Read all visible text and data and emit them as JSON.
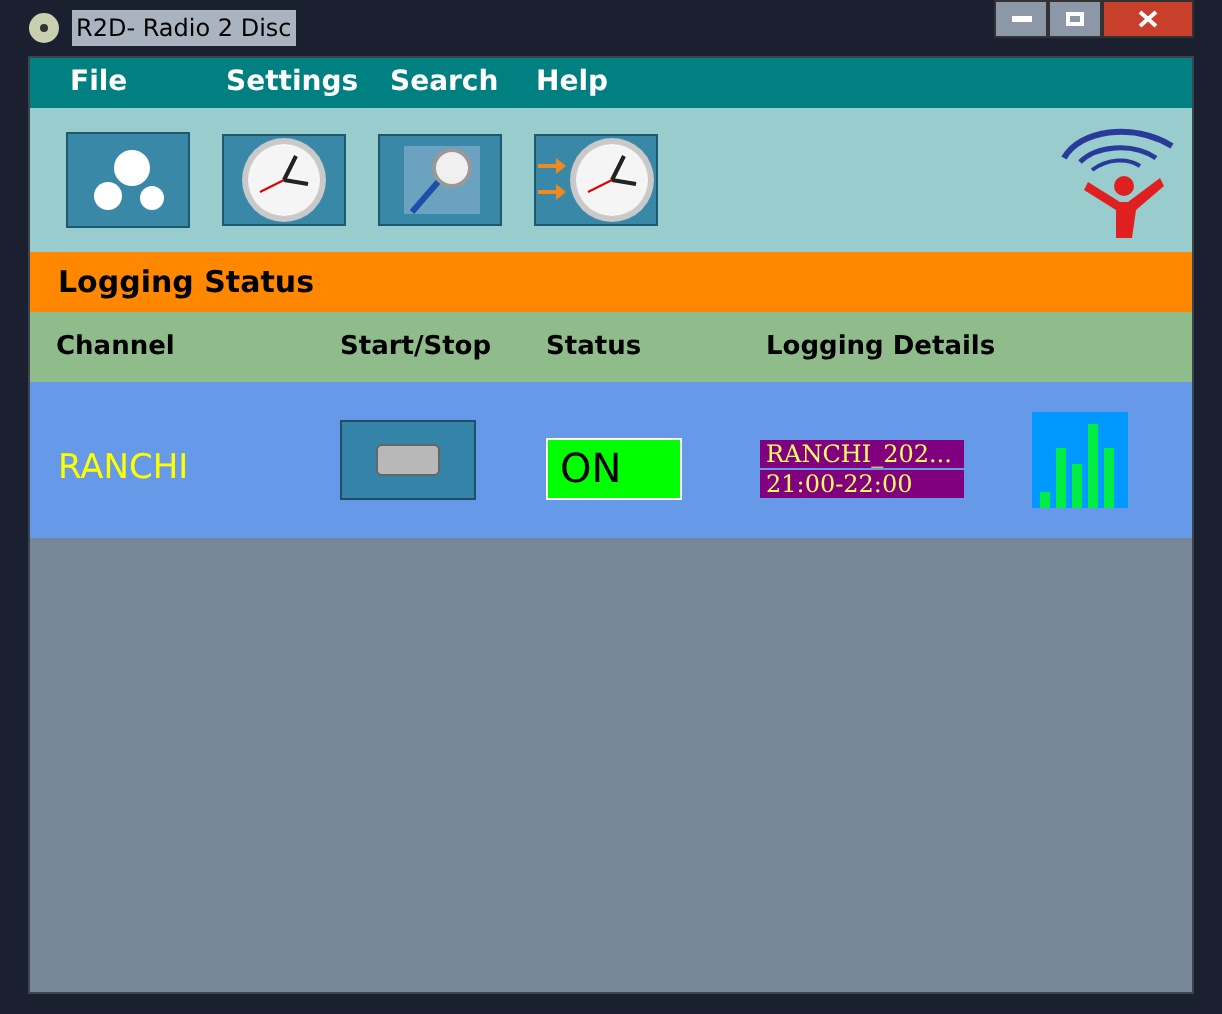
{
  "window": {
    "title": "R2D- Radio 2 Disc"
  },
  "menu": [
    "File",
    "Settings",
    "Search",
    "Help"
  ],
  "section": {
    "title": "Logging Status"
  },
  "table": {
    "columns": [
      "Channel",
      "Start/Stop",
      "Status",
      "Logging Details"
    ],
    "rows": [
      {
        "channel": "RANCHI",
        "status": "ON",
        "on": true,
        "details": [
          "RANCHI_202...",
          "21:00-22:00"
        ]
      }
    ]
  }
}
